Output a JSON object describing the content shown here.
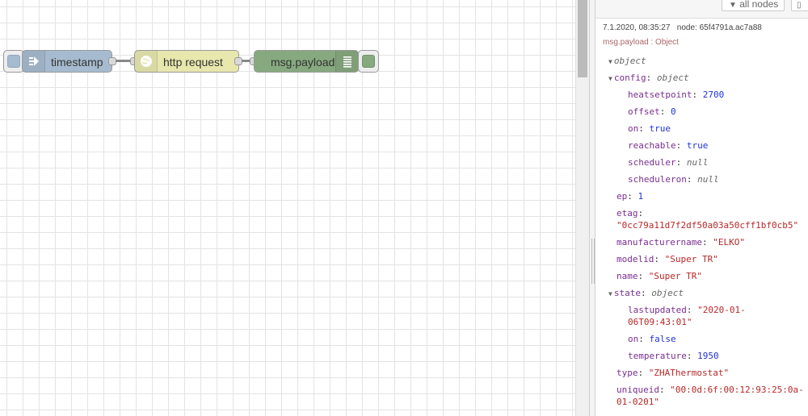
{
  "flow": {
    "nodes": [
      {
        "label": "timestamp",
        "color": "#a6bbcf",
        "icon": "inject-arrow-icon"
      },
      {
        "label": "http request",
        "color": "#e7e7ae",
        "icon": "globe-icon"
      },
      {
        "label": "msg.payload",
        "color": "#87a980",
        "icon": "debug-list-icon"
      }
    ]
  },
  "sidebar": {
    "toolbar": {
      "filter_label": "all nodes"
    },
    "message": {
      "timestamp": "7.1.2020, 08:35:27",
      "node": "node: 65f4791a.ac7a88",
      "topic": "msg.payload : Object",
      "root_type": "object",
      "config_key": "config",
      "config_type": "object",
      "config": [
        {
          "key": "heatsetpoint",
          "value": "2700",
          "kind": "num"
        },
        {
          "key": "offset",
          "value": "0",
          "kind": "num"
        },
        {
          "key": "on",
          "value": "true",
          "kind": "bool"
        },
        {
          "key": "reachable",
          "value": "true",
          "kind": "bool"
        },
        {
          "key": "scheduler",
          "value": "null",
          "kind": "nul"
        },
        {
          "key": "scheduleron",
          "value": "null",
          "kind": "nul"
        }
      ],
      "ep_key": "ep",
      "ep_value": "1",
      "etag_key": "etag",
      "etag_value": "\"0cc79a11d7f2df50a03a50cff1bf0cb5\"",
      "manufacturer_key": "manufacturername",
      "manufacturer_value": "\"ELKO\"",
      "modelid_key": "modelid",
      "modelid_value": "\"Super TR\"",
      "name_key": "name",
      "name_value": "\"Super TR\"",
      "state_key": "state",
      "state_type": "object",
      "lastupdated_key": "lastupdated",
      "lastupdated_value_1": "\"2020-01-",
      "lastupdated_value_2": "06T09:43:01\"",
      "state_on_key": "on",
      "state_on_value": "false",
      "temperature_key": "temperature",
      "temperature_value": "1950",
      "type_key": "type",
      "type_value": "\"ZHAThermostat\"",
      "uniqueid_key": "uniqueid",
      "uniqueid_value_1": "\"00:0d:6f:00:12:93:25:0a-",
      "uniqueid_value_2": "01-0201\""
    }
  }
}
